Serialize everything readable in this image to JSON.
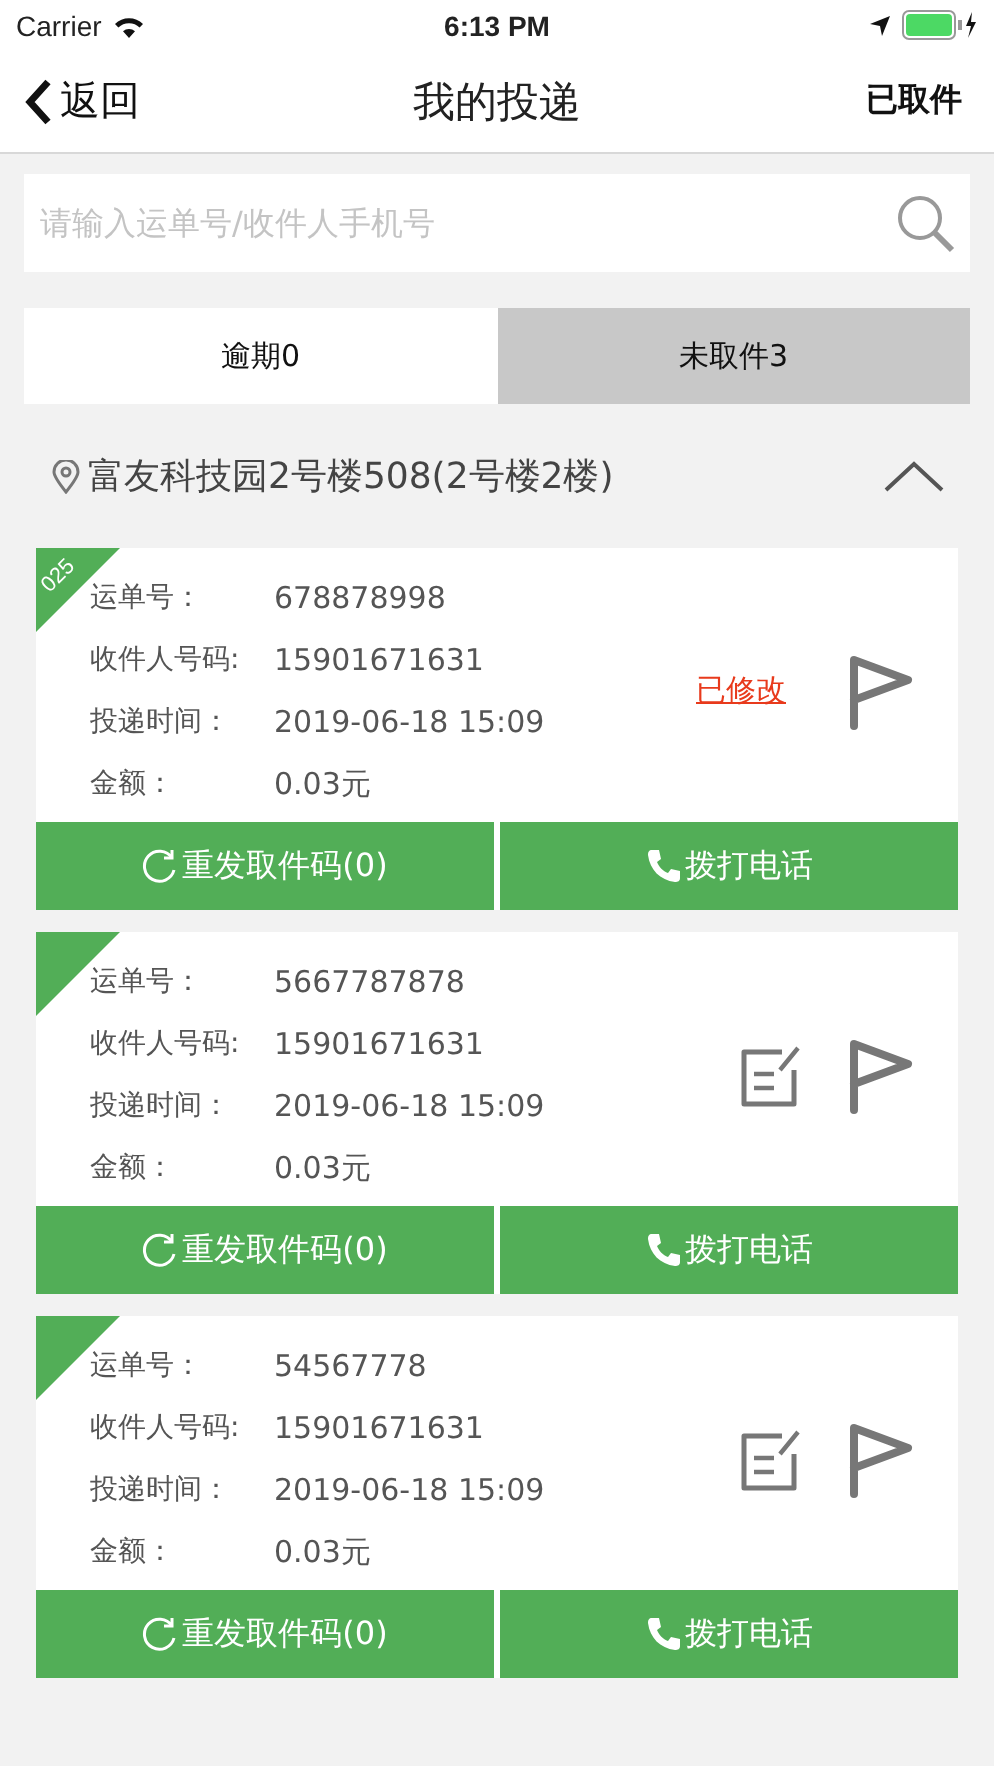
{
  "status_bar": {
    "carrier": "Carrier",
    "time": "6:13 PM"
  },
  "nav": {
    "back": "返回",
    "title": "我的投递",
    "action": "已取件"
  },
  "search": {
    "placeholder": "请输入运单号/收件人手机号"
  },
  "tabs": [
    {
      "label": "逾期0",
      "selected": false
    },
    {
      "label": "未取件3",
      "selected": true
    }
  ],
  "location": {
    "text": "富友科技园2号楼508(2号楼2楼)",
    "expanded": true
  },
  "cards": [
    {
      "kind": "modified",
      "corner_label": "025",
      "status_text": "已修改",
      "fields": [
        {
          "label": "运单号：",
          "value": "678878998"
        },
        {
          "label": "收件人号码:",
          "value": "15901671631"
        },
        {
          "label": "投递时间：",
          "value": "2019-06-18 15:09"
        },
        {
          "label": "金额：",
          "value": "0.03元"
        }
      ],
      "buttons": [
        "重发取件码(0)",
        "拨打电话"
      ]
    },
    {
      "kind": "editable",
      "fields": [
        {
          "label": "运单号：",
          "value": "5667787878"
        },
        {
          "label": "收件人号码:",
          "value": "15901671631"
        },
        {
          "label": "投递时间：",
          "value": "2019-06-18 15:09"
        },
        {
          "label": "金额：",
          "value": "0.03元"
        }
      ],
      "buttons": [
        "重发取件码(0)",
        "拨打电话"
      ]
    },
    {
      "kind": "editable",
      "fields": [
        {
          "label": "运单号：",
          "value": "54567778"
        },
        {
          "label": "收件人号码:",
          "value": "15901671631"
        },
        {
          "label": "投递时间：",
          "value": "2019-06-18 15:09"
        },
        {
          "label": "金额：",
          "value": "0.03元"
        }
      ],
      "buttons": [
        "重发取件码(0)",
        "拨打电话"
      ]
    }
  ]
}
